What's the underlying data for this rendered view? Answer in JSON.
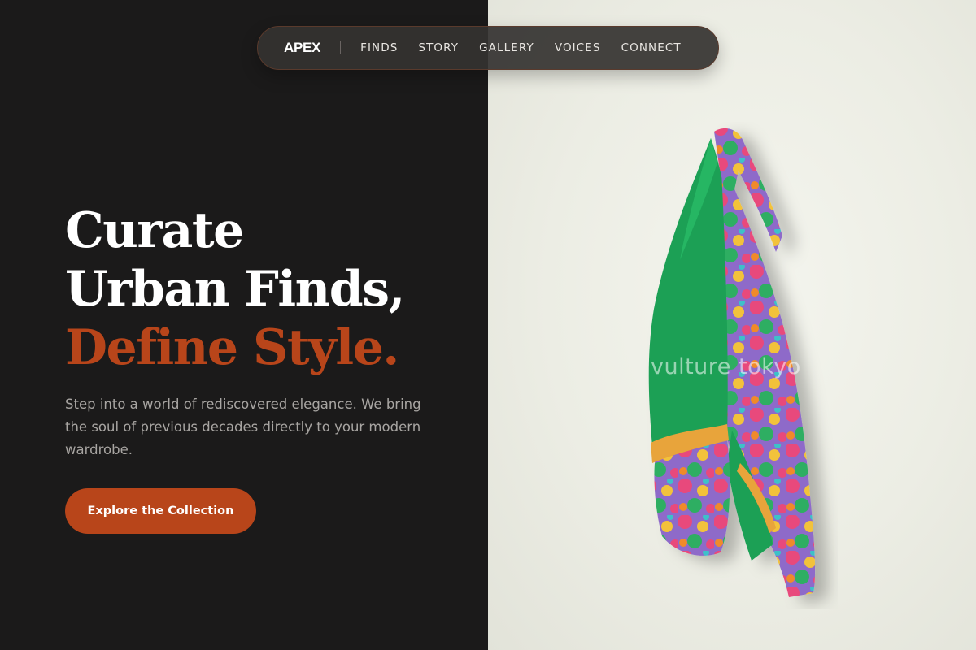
{
  "nav": {
    "brand": "APEX",
    "links": [
      "FINDS",
      "STORY",
      "GALLERY",
      "VOICES",
      "CONNECT"
    ]
  },
  "hero": {
    "title_line1": "Curate",
    "title_line2": "Urban Finds,",
    "title_accent": "Define Style.",
    "subtitle": "Step into a world of rediscovered elegance. We bring the soul of previous decades directly to your modern wardrobe.",
    "cta_label": "Explore the Collection"
  },
  "image": {
    "subject": "floral-green-jacket",
    "watermark": "vulture tokyo"
  },
  "colors": {
    "background_dark": "#1b1a1a",
    "accent": "#b8451a",
    "image_background": "#eceee6"
  }
}
